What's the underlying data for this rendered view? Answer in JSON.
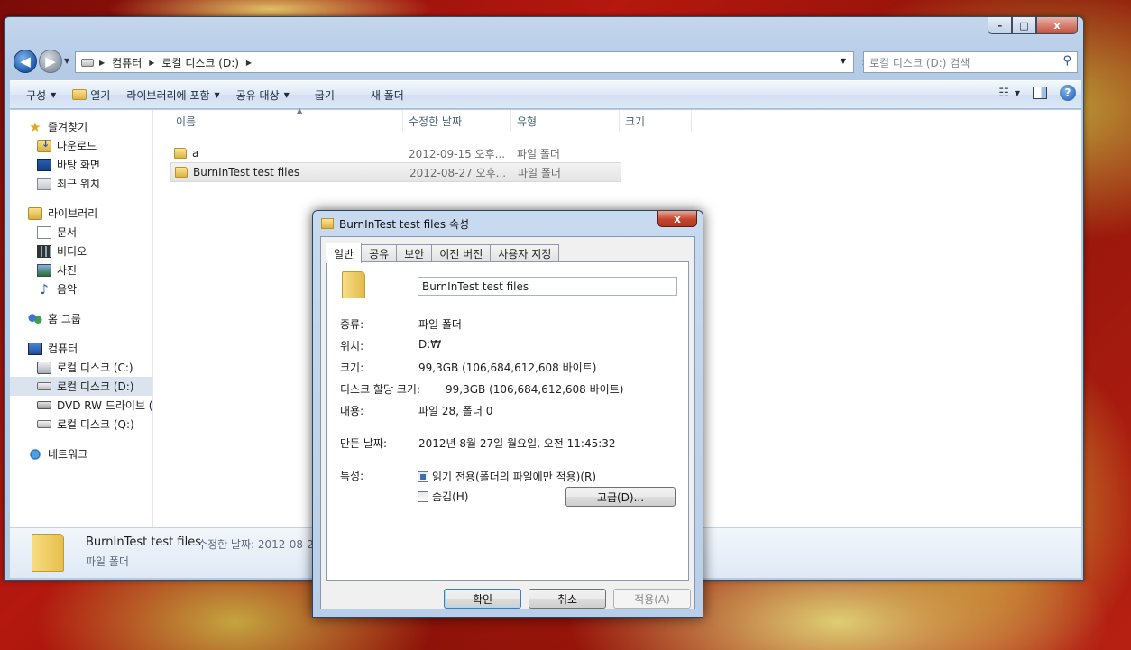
{
  "explorer": {
    "caption_buttons": {
      "minimize": "–",
      "maximize": "□",
      "close": "x"
    },
    "address": {
      "crumbs": [
        "컴퓨터",
        "로컬 디스크 (D:)"
      ]
    },
    "search": {
      "placeholder": "로컬 디스크 (D:) 검색"
    },
    "toolbar": {
      "organize": "구성",
      "open": "열기",
      "include_library": "라이브러리에 포함",
      "share": "공유 대상",
      "burn": "굽기",
      "new_folder": "새 폴더"
    },
    "nav": {
      "favorites": "즐겨찾기",
      "downloads": "다운로드",
      "desktop": "바탕 화면",
      "recent": "최근 위치",
      "libraries": "라이브러리",
      "documents": "문서",
      "videos": "비디오",
      "pictures": "사진",
      "music": "음악",
      "homegroup": "홈 그룹",
      "computer": "컴퓨터",
      "disk_c": "로컬 디스크 (C:)",
      "disk_d": "로컬 디스크 (D:)",
      "dvd": "DVD RW 드라이브 (",
      "disk_q": "로컬 디스크 (Q:)",
      "network": "네트워크"
    },
    "columns": {
      "name": "이름",
      "modified": "수정한 날짜",
      "type": "유형",
      "size": "크기"
    },
    "files": [
      {
        "name": "a",
        "modified": "2012-09-15 오후...",
        "type": "파일 폴더"
      },
      {
        "name": "BurnInTest test files",
        "modified": "2012-08-27 오후...",
        "type": "파일 폴더"
      }
    ],
    "details": {
      "name": "BurnInTest test files",
      "meta": "수정한 날짜: 2012-08-2",
      "type": "파일 폴더"
    }
  },
  "dialog": {
    "title": "BurnInTest test files 속성",
    "close": "x",
    "tabs": [
      "일반",
      "공유",
      "보안",
      "이전 버전",
      "사용자 지정"
    ],
    "folder_name": "BurnInTest test files",
    "props": {
      "type_label": "종류:",
      "type_value": "파일 폴더",
      "location_label": "위치:",
      "location_value": "D:₩",
      "size_label": "크기:",
      "size_value": "99,3GB (106,684,612,608 바이트)",
      "disk_size_label": "디스크 할당 크기:",
      "disk_size_value": "99,3GB (106,684,612,608 바이트)",
      "contents_label": "내용:",
      "contents_value": "파일 28, 폴더 0",
      "created_label": "만든 날짜:",
      "created_value": "2012년 8월 27일 월요일, 오전 11:45:32",
      "attributes_label": "특성:"
    },
    "readonly_label": "읽기 전용(폴더의 파일에만 적용)(R)",
    "hidden_label": "숨김(H)",
    "advanced_button": "고급(D)...",
    "ok_button": "확인",
    "cancel_button": "취소",
    "apply_button": "적용(A)"
  }
}
